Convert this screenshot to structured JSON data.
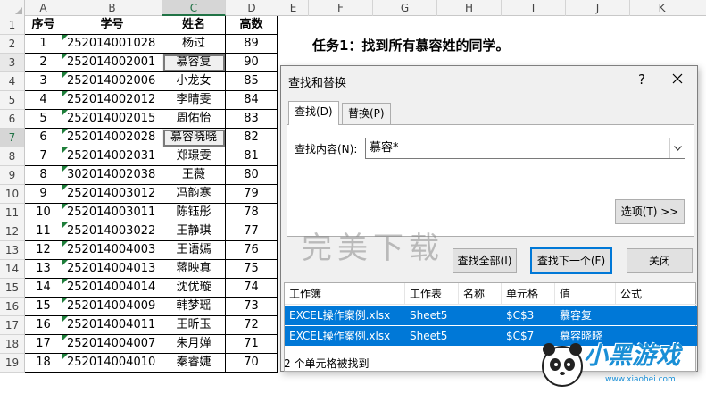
{
  "columns": [
    "A",
    "B",
    "C",
    "D",
    "E",
    "F",
    "G",
    "H",
    "I",
    "J",
    "K"
  ],
  "active_column": "C",
  "rows": [
    "1",
    "2",
    "3",
    "4",
    "5",
    "6",
    "7",
    "8",
    "9",
    "10",
    "11",
    "12",
    "13",
    "14",
    "15",
    "16",
    "17",
    "18",
    "19"
  ],
  "active_row": "7",
  "table": {
    "headers": [
      "序号",
      "学号",
      "姓名",
      "高数"
    ],
    "records": [
      {
        "no": "1",
        "id": "252014001028",
        "name": "杨过",
        "score": "89"
      },
      {
        "no": "2",
        "id": "252014002001",
        "name": "慕容复",
        "score": "90"
      },
      {
        "no": "3",
        "id": "252014002006",
        "name": "小龙女",
        "score": "85"
      },
      {
        "no": "4",
        "id": "252014002012",
        "name": "李晴雯",
        "score": "84"
      },
      {
        "no": "5",
        "id": "252014002015",
        "name": "周佑怡",
        "score": "83"
      },
      {
        "no": "6",
        "id": "252014002028",
        "name": "慕容晓晓",
        "score": "82"
      },
      {
        "no": "7",
        "id": "252014002031",
        "name": "郑璟雯",
        "score": "81"
      },
      {
        "no": "8",
        "id": "302014002038",
        "name": "王薇",
        "score": "80"
      },
      {
        "no": "9",
        "id": "252014003012",
        "name": "冯韵寒",
        "score": "79"
      },
      {
        "no": "10",
        "id": "252014003011",
        "name": "陈钰彤",
        "score": "78"
      },
      {
        "no": "11",
        "id": "252014003022",
        "name": "王静琪",
        "score": "77"
      },
      {
        "no": "12",
        "id": "252014004003",
        "name": "王语嫣",
        "score": "76"
      },
      {
        "no": "13",
        "id": "252014004013",
        "name": "蒋映真",
        "score": "75"
      },
      {
        "no": "14",
        "id": "252014004014",
        "name": "沈优璇",
        "score": "74"
      },
      {
        "no": "15",
        "id": "252014004009",
        "name": "韩梦瑶",
        "score": "73"
      },
      {
        "no": "16",
        "id": "252014004011",
        "name": "王昕玉",
        "score": "72"
      },
      {
        "no": "17",
        "id": "252014004007",
        "name": "朱月婵",
        "score": "71"
      },
      {
        "no": "18",
        "id": "252014004010",
        "name": "秦睿婕",
        "score": "70"
      }
    ]
  },
  "task_title": "任务1：找到所有慕容姓的同学。",
  "dialog": {
    "title": "查找和替换",
    "help_label": "?",
    "close_icon": "close-icon",
    "tabs": [
      "查找(D)",
      "替换(P)"
    ],
    "active_tab": "查找(D)",
    "find_label": "查找内容(N):",
    "find_value": "慕容*",
    "options_button": "选项(T) >>",
    "find_all_button": "查找全部(I)",
    "find_next_button": "查找下一个(F)",
    "close_button": "关闭",
    "results_headers": [
      "工作簿",
      "工作表",
      "名称",
      "单元格",
      "值",
      "公式"
    ],
    "results": [
      {
        "workbook": "EXCEL操作案例.xlsx",
        "sheet": "Sheet5",
        "name": "",
        "cell": "$C$3",
        "value": "慕容复",
        "formula": ""
      },
      {
        "workbook": "EXCEL操作案例.xlsx",
        "sheet": "Sheet5",
        "name": "",
        "cell": "$C$7",
        "value": "慕容晓晓",
        "formula": ""
      }
    ],
    "status": "2 个单元格被找到",
    "accent_color": "#0078d7"
  },
  "watermark": "完美下载",
  "logo": {
    "text": "小黑游戏",
    "url": "www.xiaohei.com"
  },
  "colors": {
    "excel_green": "#217346",
    "selection_blue": "#0078d7"
  }
}
